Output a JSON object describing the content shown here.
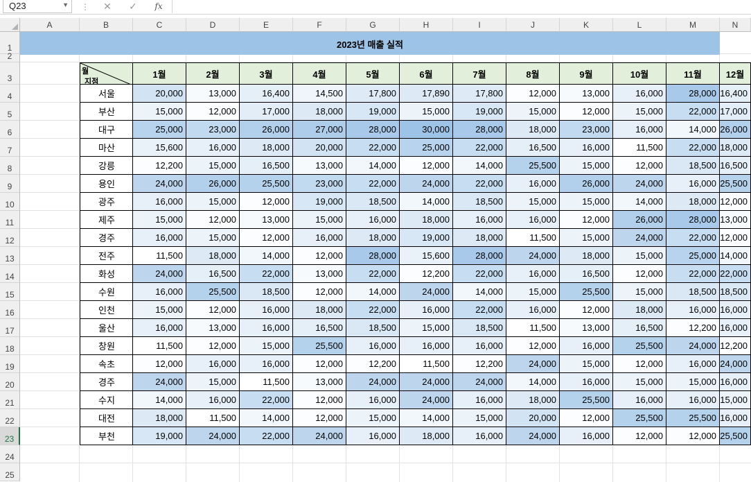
{
  "formula_bar": {
    "name_box": "Q23",
    "cancel_icon": "✕",
    "enter_icon": "✓",
    "fx_label": "fx",
    "formula": ""
  },
  "columns": [
    "A",
    "B",
    "C",
    "D",
    "E",
    "F",
    "G",
    "H",
    "I",
    "J",
    "K",
    "L",
    "M",
    "N"
  ],
  "rows": [
    "1",
    "2",
    "3",
    "4",
    "5",
    "6",
    "7",
    "8",
    "9",
    "10",
    "11",
    "12",
    "13",
    "14",
    "15",
    "16",
    "17",
    "18",
    "19",
    "20",
    "21",
    "22",
    "23",
    "24",
    "25"
  ],
  "selected_row": "23",
  "sheet": {
    "title": "2023년 매출 실적",
    "corner_top": "월",
    "corner_bottom": "지점",
    "months": [
      "1월",
      "2월",
      "3월",
      "4월",
      "5월",
      "6월",
      "7월",
      "8월",
      "9월",
      "10월",
      "11월",
      "12월"
    ],
    "branches": [
      "서울",
      "부산",
      "대구",
      "마산",
      "강릉",
      "용인",
      "광주",
      "제주",
      "경주",
      "전주",
      "화성",
      "수원",
      "인천",
      "울산",
      "창원",
      "속초",
      "경주",
      "수지",
      "대전",
      "부천"
    ],
    "values": [
      [
        "20,000",
        "13,000",
        "16,400",
        "14,500",
        "17,800",
        "17,890",
        "17,800",
        "12,000",
        "13,000",
        "16,000",
        "28,000",
        "16,400"
      ],
      [
        "15,000",
        "12,000",
        "17,000",
        "18,000",
        "19,000",
        "15,000",
        "19,000",
        "15,000",
        "12,000",
        "15,000",
        "22,000",
        "17,000"
      ],
      [
        "25,000",
        "23,000",
        "26,000",
        "27,000",
        "28,000",
        "30,000",
        "28,000",
        "18,000",
        "23,000",
        "16,000",
        "14,000",
        "26,000"
      ],
      [
        "15,600",
        "16,000",
        "18,000",
        "20,000",
        "22,000",
        "25,000",
        "22,000",
        "16,500",
        "16,000",
        "11,500",
        "22,000",
        "18,000"
      ],
      [
        "12,200",
        "15,000",
        "16,500",
        "13,000",
        "14,000",
        "12,000",
        "14,000",
        "25,500",
        "15,000",
        "12,000",
        "18,500",
        "16,500"
      ],
      [
        "24,000",
        "26,000",
        "25,500",
        "23,000",
        "22,000",
        "24,000",
        "22,000",
        "16,000",
        "26,000",
        "24,000",
        "16,000",
        "25,500"
      ],
      [
        "16,000",
        "15,000",
        "12,000",
        "19,000",
        "18,500",
        "14,000",
        "18,500",
        "15,000",
        "15,000",
        "14,000",
        "18,000",
        "12,000"
      ],
      [
        "15,000",
        "12,000",
        "13,000",
        "15,000",
        "16,000",
        "18,000",
        "16,000",
        "16,000",
        "12,000",
        "26,000",
        "28,000",
        "13,000"
      ],
      [
        "16,000",
        "15,000",
        "12,000",
        "16,000",
        "18,000",
        "19,000",
        "18,000",
        "11,500",
        "15,000",
        "24,000",
        "22,000",
        "12,000"
      ],
      [
        "11,500",
        "18,000",
        "14,000",
        "12,000",
        "28,000",
        "15,600",
        "28,000",
        "24,000",
        "18,000",
        "15,000",
        "25,000",
        "14,000"
      ],
      [
        "24,000",
        "16,500",
        "22,000",
        "13,000",
        "22,000",
        "12,200",
        "22,000",
        "16,000",
        "16,500",
        "12,000",
        "22,000",
        "22,000"
      ],
      [
        "16,000",
        "25,500",
        "18,500",
        "12,000",
        "14,000",
        "24,000",
        "14,000",
        "15,000",
        "25,500",
        "15,000",
        "18,500",
        "18,500"
      ],
      [
        "15,000",
        "12,000",
        "16,000",
        "18,000",
        "22,000",
        "16,000",
        "22,000",
        "16,000",
        "12,000",
        "18,000",
        "16,000",
        "16,000"
      ],
      [
        "16,000",
        "13,000",
        "16,000",
        "16,500",
        "18,500",
        "15,000",
        "18,500",
        "11,500",
        "13,000",
        "16,500",
        "12,200",
        "16,000"
      ],
      [
        "11,500",
        "12,000",
        "15,000",
        "25,500",
        "16,000",
        "16,000",
        "16,000",
        "12,000",
        "16,000",
        "25,500",
        "24,000",
        "12,200"
      ],
      [
        "12,000",
        "16,000",
        "16,000",
        "12,000",
        "12,200",
        "11,500",
        "12,200",
        "24,000",
        "15,000",
        "12,000",
        "16,000",
        "24,000"
      ],
      [
        "24,000",
        "15,000",
        "11,500",
        "13,000",
        "24,000",
        "24,000",
        "24,000",
        "14,000",
        "16,000",
        "15,000",
        "15,000",
        "16,000"
      ],
      [
        "14,000",
        "16,000",
        "22,000",
        "12,000",
        "16,000",
        "24,000",
        "16,000",
        "18,000",
        "25,500",
        "16,000",
        "16,000",
        "15,000"
      ],
      [
        "18,000",
        "11,500",
        "14,000",
        "12,000",
        "15,000",
        "14,000",
        "15,000",
        "20,000",
        "12,000",
        "25,500",
        "25,500",
        "16,000"
      ],
      [
        "19,000",
        "24,000",
        "22,000",
        "24,000",
        "16,000",
        "18,000",
        "16,000",
        "24,000",
        "16,000",
        "12,000",
        "12,000",
        "25,500"
      ]
    ]
  },
  "colors": {
    "title_fill": "#9dc3e6",
    "header_fill": "#e2efda",
    "scale_low": "#ffffff",
    "scale_high": "#9dc3e6",
    "selected_row_header": "#217346"
  }
}
